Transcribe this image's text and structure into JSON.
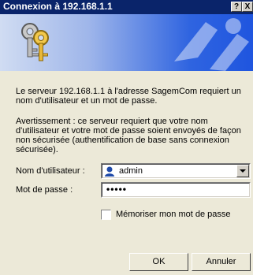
{
  "window": {
    "title": "Connexion à 192.168.1.1",
    "help_label": "?",
    "close_label": "X"
  },
  "message": {
    "line1": "Le serveur 192.168.1.1 à l'adresse SagemCom requiert un nom d'utilisateur et un mot de passe.",
    "line2": "Avertissement : ce serveur requiert que votre nom d'utilisateur et votre mot de passe soient envoyés de façon non sécurisée (authentification de base sans connexion sécurisée)."
  },
  "form": {
    "username_label": "Nom d'utilisateur :",
    "username_value": "admin",
    "password_label": "Mot de passe :",
    "password_value": "•••••",
    "remember_label": "Mémoriser mon mot de passe"
  },
  "buttons": {
    "ok": "OK",
    "cancel": "Annuler"
  },
  "colors": {
    "titlebar": "#0a246a",
    "banner_blue": "#2f64e0",
    "dialog_bg": "#ece9d8"
  }
}
